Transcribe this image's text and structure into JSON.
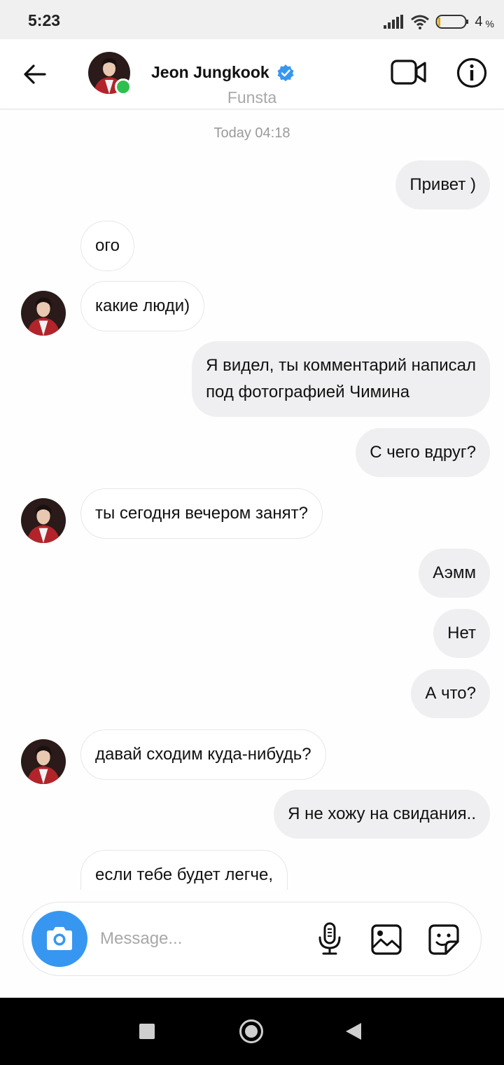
{
  "status_bar": {
    "time": "5:23",
    "battery_level": "4",
    "battery_unit": "%"
  },
  "header": {
    "contact_name": "Jeon Jungkook",
    "subtitle": "Funsta",
    "online": true,
    "verified": true,
    "icons": [
      "back-arrow-icon",
      "verified-badge-icon",
      "video-call-icon",
      "info-icon"
    ]
  },
  "chat": {
    "day_label": "Today 04:18",
    "messages": [
      {
        "dir": "out",
        "text": "Привет )"
      },
      {
        "dir": "in",
        "text": "ого",
        "avatar": false
      },
      {
        "dir": "in",
        "text": "какие люди)",
        "avatar": true
      },
      {
        "dir": "out",
        "text": "Я видел, ты комментарий написал\nпод фотографией Чимина"
      },
      {
        "dir": "out",
        "text": "С чего вдруг?"
      },
      {
        "dir": "in",
        "text": "ты сегодня вечером занят?",
        "avatar": true
      },
      {
        "dir": "out",
        "text": "Аэмм"
      },
      {
        "dir": "out",
        "text": "Нет"
      },
      {
        "dir": "out",
        "text": "А что?"
      },
      {
        "dir": "in",
        "text": "давай сходим куда-нибудь?",
        "avatar": true
      },
      {
        "dir": "out",
        "text": "Я не хожу на свидания.."
      },
      {
        "dir": "in",
        "text": "если тебе будет легче,",
        "avatar": false
      }
    ]
  },
  "composer": {
    "placeholder": "Message...",
    "value": "",
    "icons": [
      "camera-icon",
      "microphone-icon",
      "gallery-icon",
      "sticker-icon"
    ]
  },
  "colors": {
    "accent": "#3797f0",
    "online": "#2ec04f",
    "outgoing_bubble": "#efeff1",
    "incoming_border": "#e7e7e7"
  }
}
